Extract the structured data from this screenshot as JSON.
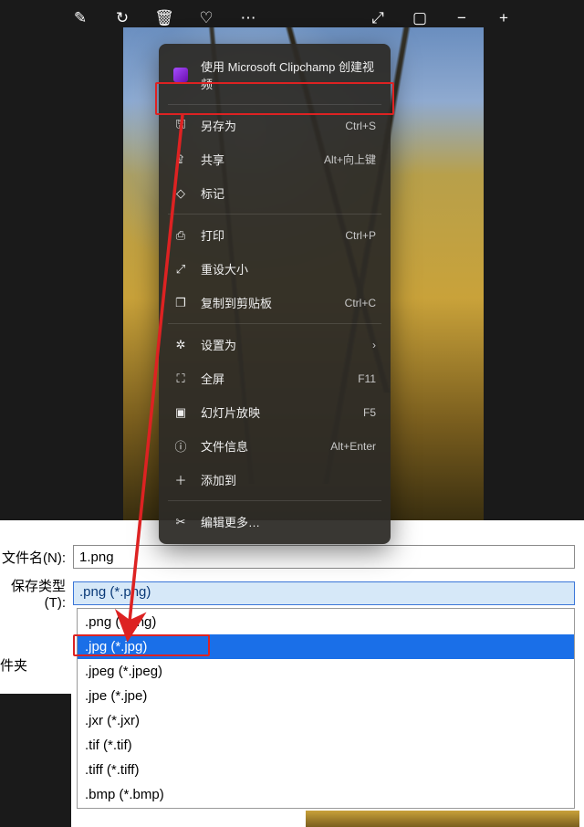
{
  "toolbar_icons": {
    "edit": "✎",
    "rotate": "↻",
    "delete": "🗑",
    "favorite": "♡",
    "more": "⋯",
    "open": "⤢",
    "slideshow": "▢",
    "zoom_out": "−",
    "zoom_in": "+"
  },
  "context_menu": {
    "clipchamp": "使用 Microsoft Clipchamp 创建视频",
    "items": [
      {
        "icon": "save",
        "label": "另存为",
        "shortcut": "Ctrl+S"
      },
      {
        "icon": "share",
        "label": "共享",
        "shortcut": "Alt+向上键"
      },
      {
        "icon": "tag",
        "label": "标记",
        "shortcut": ""
      },
      {
        "icon": "print",
        "label": "打印",
        "shortcut": "Ctrl+P"
      },
      {
        "icon": "resize",
        "label": "重设大小",
        "shortcut": ""
      },
      {
        "icon": "copy",
        "label": "复制到剪贴板",
        "shortcut": "Ctrl+C"
      },
      {
        "icon": "setas",
        "label": "设置为",
        "shortcut": "›"
      },
      {
        "icon": "full",
        "label": "全屏",
        "shortcut": "F11"
      },
      {
        "icon": "slide",
        "label": "幻灯片放映",
        "shortcut": "F5"
      },
      {
        "icon": "info",
        "label": "文件信息",
        "shortcut": "Alt+Enter"
      },
      {
        "icon": "add",
        "label": "添加到",
        "shortcut": ""
      },
      {
        "icon": "editm",
        "label": "编辑更多…",
        "shortcut": ""
      }
    ],
    "icon_glyph": {
      "save": "🖫",
      "share": "⇪",
      "tag": "◇",
      "print": "⎙",
      "resize": "⤢",
      "copy": "❐",
      "setas": "✲",
      "full": "⛶",
      "slide": "▣",
      "info": "ⓘ",
      "add": "＋",
      "editm": "✂"
    }
  },
  "save_dialog": {
    "filename_label": "文件名(N):",
    "filename_value": "1.png",
    "filetype_label": "保存类型(T):",
    "filetype_value": ".png (*.png)",
    "folder_label": "件夹",
    "options": [
      ".png (*.png)",
      ".jpg (*.jpg)",
      ".jpeg (*.jpeg)",
      ".jpe (*.jpe)",
      ".jxr (*.jxr)",
      ".tif (*.tif)",
      ".tiff (*.tiff)",
      ".bmp (*.bmp)"
    ],
    "selected_index": 1
  },
  "annotation": {
    "arrow_from": "另存为",
    "arrow_to": ".jpg (*.jpg)"
  }
}
